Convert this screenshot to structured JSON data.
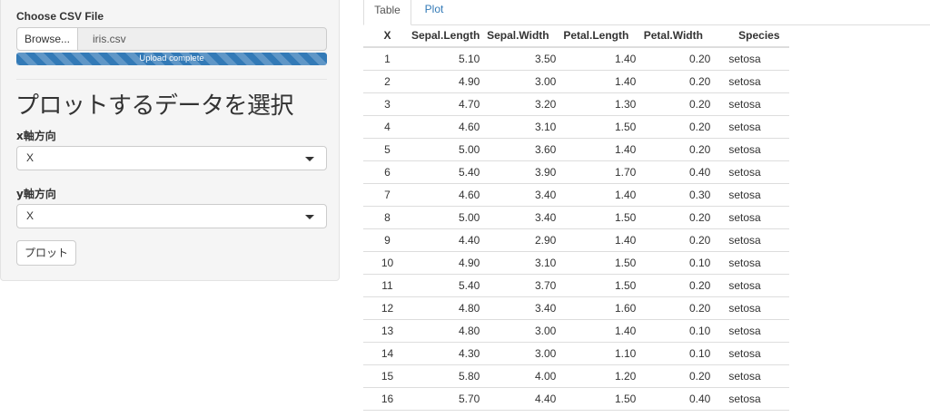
{
  "sidebar": {
    "file_label": "Choose CSV File",
    "browse_label": "Browse...",
    "file_name": "iris.csv",
    "progress_text": "Upload complete",
    "progress_fraction": 1.0,
    "heading": "プロットするデータを選択",
    "x_label": "x軸方向",
    "x_value": "X",
    "y_label": "y軸方向",
    "y_value": "X",
    "plot_button": "プロット"
  },
  "tabs": [
    {
      "label": "Table",
      "active": true
    },
    {
      "label": "Plot",
      "active": false
    }
  ],
  "table": {
    "headers": [
      "X",
      "Sepal.Length",
      "Sepal.Width",
      "Petal.Length",
      "Petal.Width",
      "Species"
    ],
    "rows": [
      [
        "1",
        "5.10",
        "3.50",
        "1.40",
        "0.20",
        "setosa"
      ],
      [
        "2",
        "4.90",
        "3.00",
        "1.40",
        "0.20",
        "setosa"
      ],
      [
        "3",
        "4.70",
        "3.20",
        "1.30",
        "0.20",
        "setosa"
      ],
      [
        "4",
        "4.60",
        "3.10",
        "1.50",
        "0.20",
        "setosa"
      ],
      [
        "5",
        "5.00",
        "3.60",
        "1.40",
        "0.20",
        "setosa"
      ],
      [
        "6",
        "5.40",
        "3.90",
        "1.70",
        "0.40",
        "setosa"
      ],
      [
        "7",
        "4.60",
        "3.40",
        "1.40",
        "0.30",
        "setosa"
      ],
      [
        "8",
        "5.00",
        "3.40",
        "1.50",
        "0.20",
        "setosa"
      ],
      [
        "9",
        "4.40",
        "2.90",
        "1.40",
        "0.20",
        "setosa"
      ],
      [
        "10",
        "4.90",
        "3.10",
        "1.50",
        "0.10",
        "setosa"
      ],
      [
        "11",
        "5.40",
        "3.70",
        "1.50",
        "0.20",
        "setosa"
      ],
      [
        "12",
        "4.80",
        "3.40",
        "1.60",
        "0.20",
        "setosa"
      ],
      [
        "13",
        "4.80",
        "3.00",
        "1.40",
        "0.10",
        "setosa"
      ],
      [
        "14",
        "4.30",
        "3.00",
        "1.10",
        "0.10",
        "setosa"
      ],
      [
        "15",
        "5.80",
        "4.00",
        "1.20",
        "0.20",
        "setosa"
      ],
      [
        "16",
        "5.70",
        "4.40",
        "1.50",
        "0.40",
        "setosa"
      ]
    ]
  },
  "colors": {
    "accent": "#337ab7",
    "sidebar_bg": "#f5f5f5",
    "border": "#dddddd"
  }
}
